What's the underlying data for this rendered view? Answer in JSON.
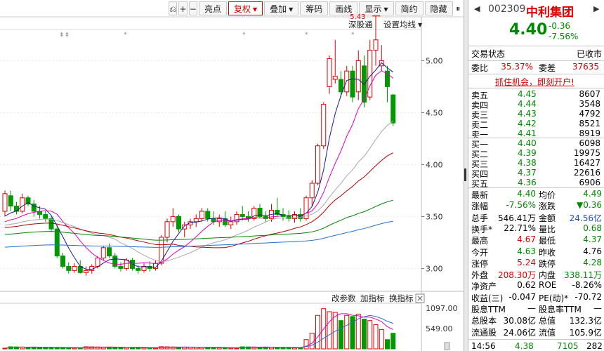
{
  "toolbar": {
    "items": [
      {
        "label": "亮点",
        "active": false,
        "caret": false
      },
      {
        "label": "复权",
        "active": true,
        "caret": true
      },
      {
        "label": "叠加",
        "active": false,
        "caret": true
      },
      {
        "label": "筹码",
        "active": false,
        "caret": false
      },
      {
        "label": "画线",
        "active": false,
        "caret": false
      },
      {
        "label": "显示",
        "active": false,
        "caret": true
      },
      {
        "label": "简约",
        "active": false,
        "caret": false
      },
      {
        "label": "隐藏",
        "active": false,
        "caret": false
      }
    ],
    "icons": [
      "restore-icon",
      "zoom-in-icon",
      "zoom-out-icon"
    ]
  },
  "chart_links": {
    "index": "深股通",
    "ma_settings": "设置均线"
  },
  "chart_data": {
    "type": "candlestick",
    "ylim": [
      2.8,
      5.3
    ],
    "yticks": [
      "5.00",
      "4.50",
      "4.00",
      "3.50",
      "3.00"
    ],
    "max_label": "5.43",
    "candles": [
      {
        "o": 3.55,
        "h": 3.75,
        "l": 3.5,
        "c": 3.72
      },
      {
        "o": 3.7,
        "h": 3.75,
        "l": 3.55,
        "c": 3.6
      },
      {
        "o": 3.6,
        "h": 3.64,
        "l": 3.52,
        "c": 3.55
      },
      {
        "o": 3.55,
        "h": 3.72,
        "l": 3.53,
        "c": 3.68
      },
      {
        "o": 3.68,
        "h": 3.7,
        "l": 3.6,
        "c": 3.62
      },
      {
        "o": 3.62,
        "h": 3.66,
        "l": 3.5,
        "c": 3.55
      },
      {
        "o": 3.55,
        "h": 3.6,
        "l": 3.48,
        "c": 3.52
      },
      {
        "o": 3.52,
        "h": 3.55,
        "l": 3.45,
        "c": 3.48
      },
      {
        "o": 3.48,
        "h": 3.5,
        "l": 3.35,
        "c": 3.38
      },
      {
        "o": 3.38,
        "h": 3.42,
        "l": 3.1,
        "c": 3.12
      },
      {
        "o": 3.12,
        "h": 3.15,
        "l": 3.0,
        "c": 3.02
      },
      {
        "o": 3.02,
        "h": 3.06,
        "l": 2.95,
        "c": 2.98
      },
      {
        "o": 2.98,
        "h": 3.05,
        "l": 2.96,
        "c": 3.02
      },
      {
        "o": 3.02,
        "h": 3.08,
        "l": 2.95,
        "c": 2.96
      },
      {
        "o": 2.96,
        "h": 3.02,
        "l": 2.93,
        "c": 2.98
      },
      {
        "o": 2.98,
        "h": 3.04,
        "l": 2.95,
        "c": 3.02
      },
      {
        "o": 3.02,
        "h": 3.12,
        "l": 3.0,
        "c": 3.1
      },
      {
        "o": 3.1,
        "h": 3.22,
        "l": 3.08,
        "c": 3.2
      },
      {
        "o": 3.2,
        "h": 3.24,
        "l": 3.1,
        "c": 3.12
      },
      {
        "o": 3.12,
        "h": 3.15,
        "l": 3.0,
        "c": 3.02
      },
      {
        "o": 3.02,
        "h": 3.06,
        "l": 2.97,
        "c": 3.0
      },
      {
        "o": 3.0,
        "h": 3.1,
        "l": 2.98,
        "c": 3.08
      },
      {
        "o": 3.08,
        "h": 3.1,
        "l": 2.98,
        "c": 3.0
      },
      {
        "o": 3.0,
        "h": 3.03,
        "l": 2.95,
        "c": 2.98
      },
      {
        "o": 2.98,
        "h": 3.05,
        "l": 2.96,
        "c": 3.02
      },
      {
        "o": 3.02,
        "h": 3.07,
        "l": 2.97,
        "c": 3.0
      },
      {
        "o": 3.0,
        "h": 3.08,
        "l": 2.98,
        "c": 3.05
      },
      {
        "o": 3.05,
        "h": 3.32,
        "l": 3.03,
        "c": 3.3
      },
      {
        "o": 3.3,
        "h": 3.48,
        "l": 3.25,
        "c": 3.45
      },
      {
        "o": 3.45,
        "h": 3.58,
        "l": 3.4,
        "c": 3.5
      },
      {
        "o": 3.5,
        "h": 3.52,
        "l": 3.35,
        "c": 3.38
      },
      {
        "o": 3.38,
        "h": 3.45,
        "l": 3.3,
        "c": 3.42
      },
      {
        "o": 3.42,
        "h": 3.48,
        "l": 3.38,
        "c": 3.45
      },
      {
        "o": 3.45,
        "h": 3.52,
        "l": 3.4,
        "c": 3.48
      },
      {
        "o": 3.48,
        "h": 3.58,
        "l": 3.45,
        "c": 3.55
      },
      {
        "o": 3.55,
        "h": 3.58,
        "l": 3.45,
        "c": 3.48
      },
      {
        "o": 3.48,
        "h": 3.55,
        "l": 3.42,
        "c": 3.45
      },
      {
        "o": 3.45,
        "h": 3.52,
        "l": 3.4,
        "c": 3.48
      },
      {
        "o": 3.48,
        "h": 3.55,
        "l": 3.4,
        "c": 3.42
      },
      {
        "o": 3.42,
        "h": 3.5,
        "l": 3.38,
        "c": 3.45
      },
      {
        "o": 3.45,
        "h": 3.55,
        "l": 3.42,
        "c": 3.52
      },
      {
        "o": 3.52,
        "h": 3.6,
        "l": 3.46,
        "c": 3.5
      },
      {
        "o": 3.5,
        "h": 3.55,
        "l": 3.45,
        "c": 3.48
      },
      {
        "o": 3.48,
        "h": 3.6,
        "l": 3.46,
        "c": 3.58
      },
      {
        "o": 3.58,
        "h": 3.62,
        "l": 3.48,
        "c": 3.5
      },
      {
        "o": 3.5,
        "h": 3.55,
        "l": 3.45,
        "c": 3.48
      },
      {
        "o": 3.48,
        "h": 3.62,
        "l": 3.45,
        "c": 3.56
      },
      {
        "o": 3.56,
        "h": 3.68,
        "l": 3.5,
        "c": 3.52
      },
      {
        "o": 3.52,
        "h": 3.58,
        "l": 3.46,
        "c": 3.5
      },
      {
        "o": 3.5,
        "h": 3.56,
        "l": 3.45,
        "c": 3.48
      },
      {
        "o": 3.48,
        "h": 3.55,
        "l": 3.44,
        "c": 3.52
      },
      {
        "o": 3.52,
        "h": 3.58,
        "l": 3.45,
        "c": 3.48
      },
      {
        "o": 3.48,
        "h": 3.7,
        "l": 3.46,
        "c": 3.68
      },
      {
        "o": 3.68,
        "h": 3.85,
        "l": 3.6,
        "c": 3.82
      },
      {
        "o": 3.82,
        "h": 4.2,
        "l": 3.8,
        "c": 4.18
      },
      {
        "o": 4.18,
        "h": 4.6,
        "l": 4.15,
        "c": 4.58
      },
      {
        "o": 4.75,
        "h": 5.05,
        "l": 4.68,
        "c": 5.02
      },
      {
        "o": 4.82,
        "h": 5.2,
        "l": 4.78,
        "c": 4.85
      },
      {
        "o": 4.82,
        "h": 4.9,
        "l": 4.65,
        "c": 4.7
      },
      {
        "o": 4.7,
        "h": 4.95,
        "l": 4.66,
        "c": 4.9
      },
      {
        "o": 4.9,
        "h": 4.95,
        "l": 4.6,
        "c": 4.65
      },
      {
        "o": 4.7,
        "h": 5.1,
        "l": 4.62,
        "c": 5.0
      },
      {
        "o": 4.95,
        "h": 5.05,
        "l": 4.55,
        "c": 4.6
      },
      {
        "o": 4.65,
        "h": 5.2,
        "l": 4.62,
        "c": 5.1
      },
      {
        "o": 5.1,
        "h": 5.43,
        "l": 4.95,
        "c": 5.2
      },
      {
        "o": 4.95,
        "h": 5.15,
        "l": 4.9,
        "c": 5.0
      },
      {
        "o": 4.9,
        "h": 4.95,
        "l": 4.6,
        "c": 4.75
      },
      {
        "o": 4.67,
        "h": 4.68,
        "l": 4.37,
        "c": 4.4
      }
    ],
    "ma_colors": [
      "#1a1a9a",
      "#e000c0",
      "#a8a8a8",
      "#b00000",
      "#008800",
      "#2070d0"
    ],
    "volume": {
      "yticks": [
        "1097.00",
        "549.00"
      ],
      "ymax": 1150,
      "links": [
        "改参数",
        "加指标",
        "换指标"
      ]
    }
  },
  "quote": {
    "code": "002309",
    "name": "中利集团",
    "price": "4.40",
    "change": "-0.36",
    "change_pct": "-7.56%",
    "status_label": "交易状态",
    "status": "已收市",
    "wei_bi_label": "委比",
    "wei_bi": "35.37%",
    "wei_cha_label": "委差",
    "wei_cha": "37635",
    "promo": "抓住机会，即刻开户!",
    "asks": [
      {
        "label": "卖五",
        "price": "4.45",
        "vol": "8607"
      },
      {
        "label": "卖四",
        "price": "4.44",
        "vol": "3548"
      },
      {
        "label": "卖三",
        "price": "4.43",
        "vol": "4792"
      },
      {
        "label": "卖二",
        "price": "4.42",
        "vol": "8521"
      },
      {
        "label": "卖一",
        "price": "4.41",
        "vol": "8919"
      }
    ],
    "bids": [
      {
        "label": "买一",
        "price": "4.40",
        "vol": "6098"
      },
      {
        "label": "买二",
        "price": "4.39",
        "vol": "19975"
      },
      {
        "label": "买三",
        "price": "4.38",
        "vol": "16427"
      },
      {
        "label": "买四",
        "price": "4.37",
        "vol": "22616"
      },
      {
        "label": "买五",
        "price": "4.36",
        "vol": "6906"
      }
    ],
    "stats": [
      [
        {
          "l": "最新",
          "v": "4.40",
          "c": "green"
        },
        {
          "l": "均价",
          "v": "4.49",
          "c": "green"
        }
      ],
      [
        {
          "l": "涨幅",
          "v": "-7.56%",
          "c": "green"
        },
        {
          "l": "涨跌",
          "v": "▼0.36",
          "c": "green"
        }
      ],
      [
        {
          "l": "总手",
          "v": "546.41万",
          "c": ""
        },
        {
          "l": "金额",
          "v": "24.56亿",
          "c": "blue"
        }
      ],
      [
        {
          "l": "换手*",
          "v": "22.71%",
          "c": ""
        },
        {
          "l": "量比",
          "v": "0.68",
          "c": "green"
        }
      ],
      [
        {
          "l": "最高",
          "v": "4.67",
          "c": "red"
        },
        {
          "l": "最低",
          "v": "4.37",
          "c": "green"
        }
      ],
      [
        {
          "l": "今开",
          "v": "4.63",
          "c": "green"
        },
        {
          "l": "昨收",
          "v": "4.76",
          "c": ""
        }
      ],
      [
        {
          "l": "涨停",
          "v": "5.24",
          "c": "red"
        },
        {
          "l": "跌停",
          "v": "4.28",
          "c": "green"
        }
      ],
      [
        {
          "l": "外盘",
          "v": "208.30万",
          "c": "red"
        },
        {
          "l": "内盘",
          "v": "338.11万",
          "c": "green"
        }
      ],
      [
        {
          "l": "净资产",
          "v": "0.62",
          "c": ""
        },
        {
          "l": "ROE",
          "v": "-8.26%",
          "c": ""
        }
      ],
      [
        {
          "l": "收益(三)",
          "v": "-0.047",
          "c": ""
        },
        {
          "l": "PE(动)*",
          "v": "-70.72",
          "c": ""
        }
      ],
      [
        {
          "l": "股息TTM",
          "v": "—",
          "c": ""
        },
        {
          "l": "股息率TTM",
          "v": "—",
          "c": ""
        }
      ],
      [
        {
          "l": "总股本",
          "v": "30.08亿",
          "c": ""
        },
        {
          "l": "总值",
          "v": "132.3亿",
          "c": ""
        }
      ],
      [
        {
          "l": "流通股",
          "v": "24.06亿",
          "c": ""
        },
        {
          "l": "流值",
          "v": "105.9亿",
          "c": ""
        }
      ]
    ],
    "tick": {
      "time": "14:56",
      "price": "4.38",
      "vol": "7105",
      "num": "282"
    }
  }
}
